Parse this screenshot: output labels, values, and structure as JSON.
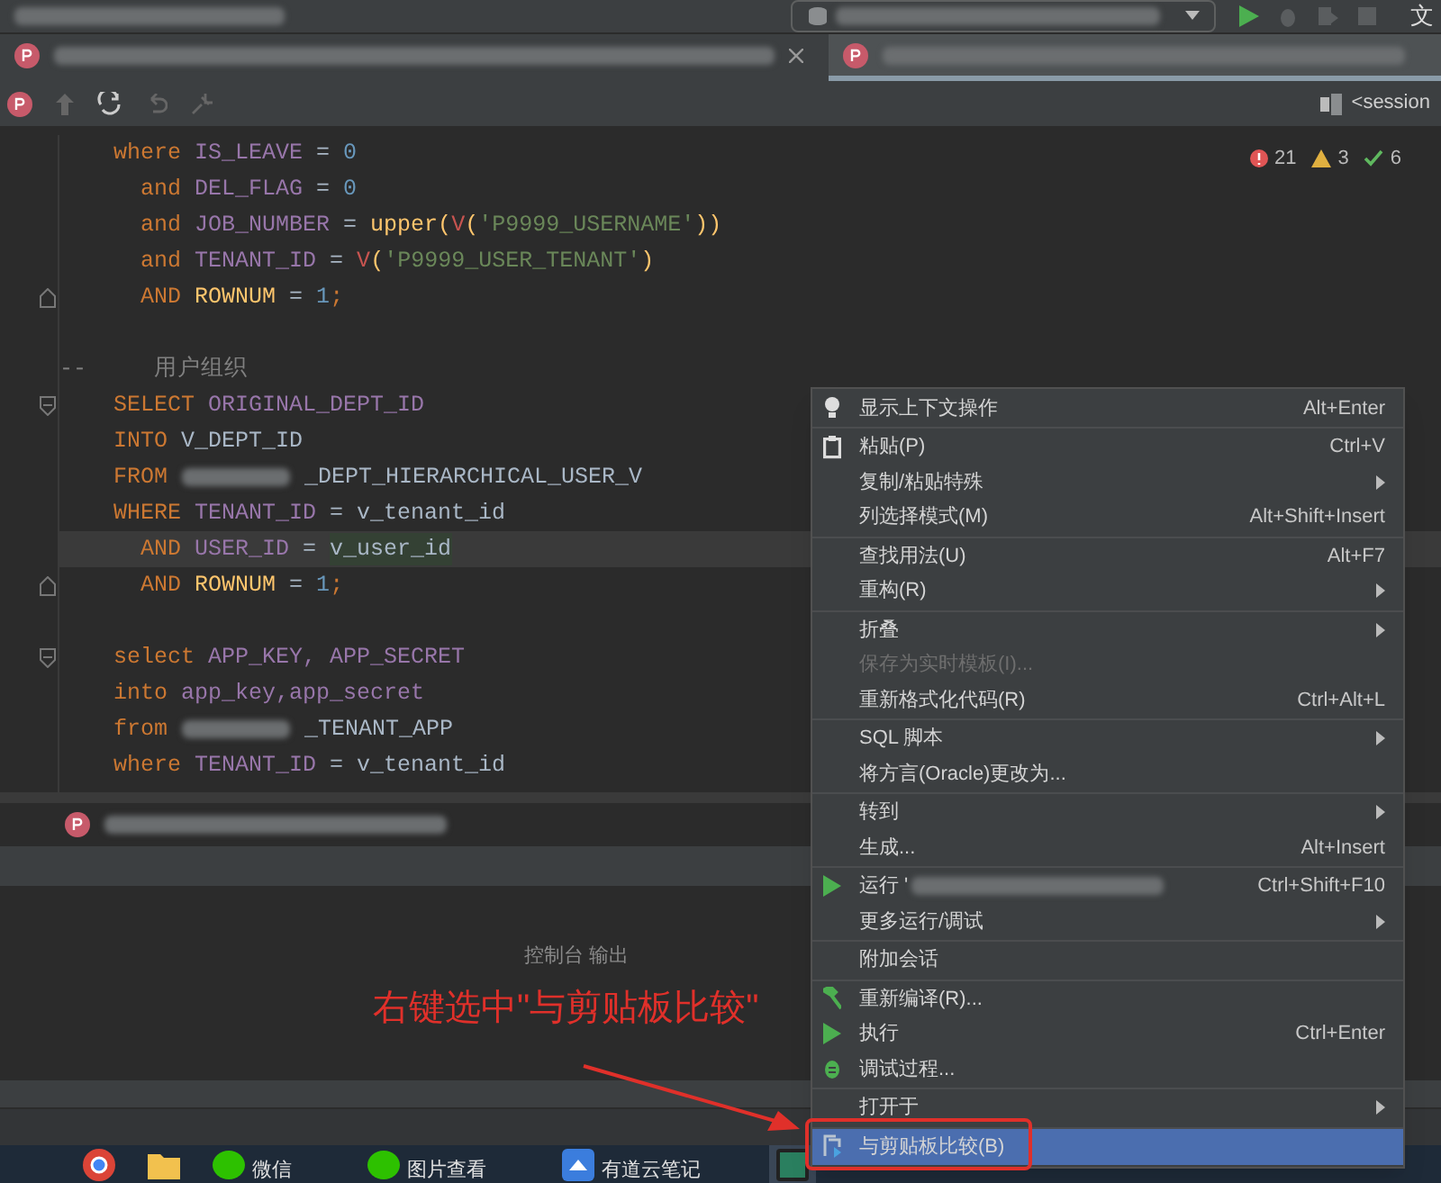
{
  "title_bar": {
    "right_text": "文"
  },
  "tabs": [
    {
      "selected": false,
      "closable": true
    },
    {
      "selected": true,
      "closable": false
    }
  ],
  "toolbar": {
    "session": "<session"
  },
  "inspections": {
    "errors": "21",
    "warnings": "3",
    "checks": "6"
  },
  "code": {
    "lines": [
      {
        "current": false,
        "tokens": [
          {
            "kind": "kw",
            "text": "    where"
          },
          {
            "kind": "id",
            "text": " IS_LEAVE"
          },
          {
            "kind": "op",
            "text": " = "
          },
          {
            "kind": "num",
            "text": "0"
          }
        ]
      },
      {
        "current": false,
        "tokens": [
          {
            "kind": "kw",
            "text": "      and"
          },
          {
            "kind": "id",
            "text": " DEL_FLAG"
          },
          {
            "kind": "op",
            "text": " = "
          },
          {
            "kind": "num",
            "text": "0"
          }
        ]
      },
      {
        "current": false,
        "tokens": [
          {
            "kind": "kw",
            "text": "      and"
          },
          {
            "kind": "id",
            "text": " JOB_NUMBER"
          },
          {
            "kind": "op",
            "text": " = "
          },
          {
            "kind": "fn",
            "text": "upper("
          },
          {
            "kind": "call",
            "text": "V"
          },
          {
            "kind": "fn",
            "text": "("
          },
          {
            "kind": "str",
            "text": "'P9999_USERNAME'"
          },
          {
            "kind": "fn",
            "text": "))"
          }
        ]
      },
      {
        "current": false,
        "tokens": [
          {
            "kind": "kw",
            "text": "      and"
          },
          {
            "kind": "id",
            "text": " TENANT_ID"
          },
          {
            "kind": "op",
            "text": " = "
          },
          {
            "kind": "call",
            "text": "V"
          },
          {
            "kind": "fn",
            "text": "("
          },
          {
            "kind": "str",
            "text": "'P9999_USER_TENANT'"
          },
          {
            "kind": "fn",
            "text": ")"
          }
        ]
      },
      {
        "current": false,
        "tokens": [
          {
            "kind": "kw",
            "text": "      AND"
          },
          {
            "kind": "fn",
            "text": " ROWNUM"
          },
          {
            "kind": "op",
            "text": " = "
          },
          {
            "kind": "num",
            "text": "1"
          },
          {
            "kind": "kw",
            "text": ";"
          }
        ]
      },
      {
        "current": false
      },
      {
        "current": false,
        "tokens": [
          {
            "kind": "comment",
            "text": "--     用户组织"
          }
        ]
      },
      {
        "current": false,
        "tokens": [
          {
            "kind": "kw",
            "text": "    SELECT"
          },
          {
            "kind": "id",
            "text": " ORIGINAL_DEPT_ID"
          }
        ]
      },
      {
        "current": false,
        "tokens": [
          {
            "kind": "kw",
            "text": "    INTO"
          },
          {
            "kind": "plain",
            "text": " V_DEPT_ID"
          }
        ]
      },
      {
        "current": false,
        "tokens": [
          {
            "kind": "kw",
            "text": "    FROM"
          },
          {
            "kind": "redacted"
          },
          {
            "kind": "plain",
            "text": "_DEPT_HIERARCHICAL_USER_V"
          }
        ]
      },
      {
        "current": false,
        "tokens": [
          {
            "kind": "kw",
            "text": "    WHERE"
          },
          {
            "kind": "id",
            "text": " TENANT_ID"
          },
          {
            "kind": "op",
            "text": " = "
          },
          {
            "kind": "plain",
            "text": "v_tenant_id"
          }
        ]
      },
      {
        "current": true,
        "tokens": [
          {
            "kind": "kw",
            "text": "      AND"
          },
          {
            "kind": "id",
            "text": " USER_ID"
          },
          {
            "kind": "op",
            "text": " = "
          },
          {
            "kind": "match",
            "text": "v_user_id"
          }
        ]
      },
      {
        "current": false,
        "tokens": [
          {
            "kind": "kw",
            "text": "      AND"
          },
          {
            "kind": "fn",
            "text": " ROWNUM"
          },
          {
            "kind": "op",
            "text": " = "
          },
          {
            "kind": "num",
            "text": "1"
          },
          {
            "kind": "kw",
            "text": ";"
          }
        ]
      },
      {
        "current": false
      },
      {
        "current": false,
        "tokens": [
          {
            "kind": "kw",
            "text": "    select"
          },
          {
            "kind": "id",
            "text": " APP_KEY, APP_SECRET"
          }
        ]
      },
      {
        "current": false,
        "tokens": [
          {
            "kind": "kw",
            "text": "    into"
          },
          {
            "kind": "id",
            "text": " app_key,app_secret"
          }
        ]
      },
      {
        "current": false,
        "tokens": [
          {
            "kind": "kw",
            "text": "    from"
          },
          {
            "kind": "redacted"
          },
          {
            "kind": "plain",
            "text": "_TENANT_APP"
          }
        ]
      },
      {
        "current": false,
        "tokens": [
          {
            "kind": "kw",
            "text": "    where"
          },
          {
            "kind": "id",
            "text": " TENANT_ID"
          },
          {
            "kind": "op",
            "text": " = "
          },
          {
            "kind": "plain",
            "text": "v_tenant_id"
          }
        ]
      }
    ]
  },
  "console": {
    "label": "控制台 输出"
  },
  "annotation": {
    "text": "右键选中\"与剪贴板比较\""
  },
  "context_menu": {
    "groups": [
      {
        "items": [
          {
            "label": "显示上下文操作",
            "shortcut": "Alt+Enter",
            "submenu": false,
            "disabled": false,
            "selected": false
          }
        ]
      },
      {
        "items": [
          {
            "label": "粘贴(P)",
            "shortcut": "Ctrl+V",
            "submenu": false,
            "disabled": false,
            "selected": false
          },
          {
            "label": "复制/粘贴特殊",
            "submenu": true,
            "disabled": false,
            "selected": false
          },
          {
            "label": "列选择模式(M)",
            "shortcut": "Alt+Shift+Insert",
            "submenu": false,
            "disabled": false,
            "selected": false
          }
        ]
      },
      {
        "items": [
          {
            "label": "查找用法(U)",
            "shortcut": "Alt+F7",
            "submenu": false,
            "disabled": false,
            "selected": false
          },
          {
            "label": "重构(R)",
            "submenu": true,
            "disabled": false,
            "selected": false
          }
        ]
      },
      {
        "items": [
          {
            "label": "折叠",
            "submenu": true,
            "disabled": false,
            "selected": false
          },
          {
            "label": "保存为实时模板(I)...",
            "submenu": false,
            "disabled": true,
            "selected": false
          },
          {
            "label": "重新格式化代码(R)",
            "shortcut": "Ctrl+Alt+L",
            "submenu": false,
            "disabled": false,
            "selected": false
          }
        ]
      },
      {
        "items": [
          {
            "label": "SQL 脚本",
            "submenu": true,
            "disabled": false,
            "selected": false
          },
          {
            "label": "将方言(Oracle)更改为...",
            "submenu": false,
            "disabled": false,
            "selected": false
          }
        ]
      },
      {
        "items": [
          {
            "label": "转到",
            "submenu": true,
            "disabled": false,
            "selected": false
          },
          {
            "label": "生成...",
            "shortcut": "Alt+Insert",
            "submenu": false,
            "disabled": false,
            "selected": false
          }
        ]
      },
      {
        "items": [
          {
            "label": "运行 '",
            "shortcut": "Ctrl+Shift+F10",
            "submenu": false,
            "disabled": false,
            "selected": false
          },
          {
            "label": "更多运行/调试",
            "submenu": true,
            "disabled": false,
            "selected": false
          }
        ]
      },
      {
        "items": [
          {
            "label": "附加会话",
            "submenu": false,
            "disabled": false,
            "selected": false
          }
        ]
      },
      {
        "items": [
          {
            "label": "重新编译(R)...",
            "submenu": false,
            "disabled": false,
            "selected": false
          },
          {
            "label": "执行",
            "shortcut": "Ctrl+Enter",
            "submenu": false,
            "disabled": false,
            "selected": false
          },
          {
            "label": "调试过程...",
            "submenu": false,
            "disabled": false,
            "selected": false
          }
        ]
      },
      {
        "items": [
          {
            "label": "打开于",
            "submenu": true,
            "disabled": false,
            "selected": false
          }
        ]
      },
      {
        "items": [
          {
            "label": "与剪贴板比较(B)",
            "submenu": false,
            "disabled": false,
            "selected": true
          }
        ]
      }
    ]
  },
  "taskbar": {
    "items": [
      {
        "label": "微信"
      },
      {
        "label": "图片查看"
      },
      {
        "label": "有道云笔记"
      }
    ]
  }
}
